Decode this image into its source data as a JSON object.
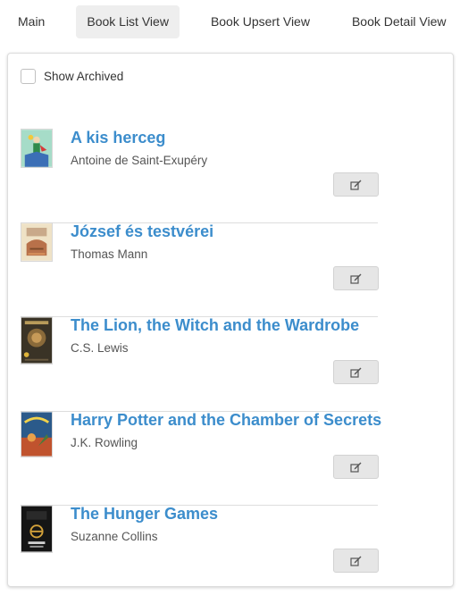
{
  "nav": {
    "tabs": [
      {
        "label": "Main"
      },
      {
        "label": "Book List View"
      },
      {
        "label": "Book Upsert View"
      },
      {
        "label": "Book Detail View"
      }
    ],
    "active": "Book List View"
  },
  "filters": {
    "show_archived_label": "Show Archived",
    "show_archived_checked": false
  },
  "books": [
    {
      "title": "A kis herceg",
      "author": "Antoine de Saint-Exupéry",
      "cover_icon": "little-prince-cover"
    },
    {
      "title": "József és testvérei",
      "author": "Thomas Mann",
      "cover_icon": "joseph-brothers-cover"
    },
    {
      "title": "The Lion, the Witch and the Wardrobe",
      "author": "C.S. Lewis",
      "cover_icon": "lion-witch-cover"
    },
    {
      "title": "Harry Potter and the Chamber of Secrets",
      "author": "J.K. Rowling",
      "cover_icon": "harry-potter-cover"
    },
    {
      "title": "The Hunger Games",
      "author": "Suzanne Collins",
      "cover_icon": "hunger-games-cover"
    }
  ],
  "edit_icon": "edit-icon",
  "colors": {
    "link": "#3c8dcc",
    "active_tab_bg": "#eeeeee",
    "button_bg": "#e6e6e6"
  }
}
